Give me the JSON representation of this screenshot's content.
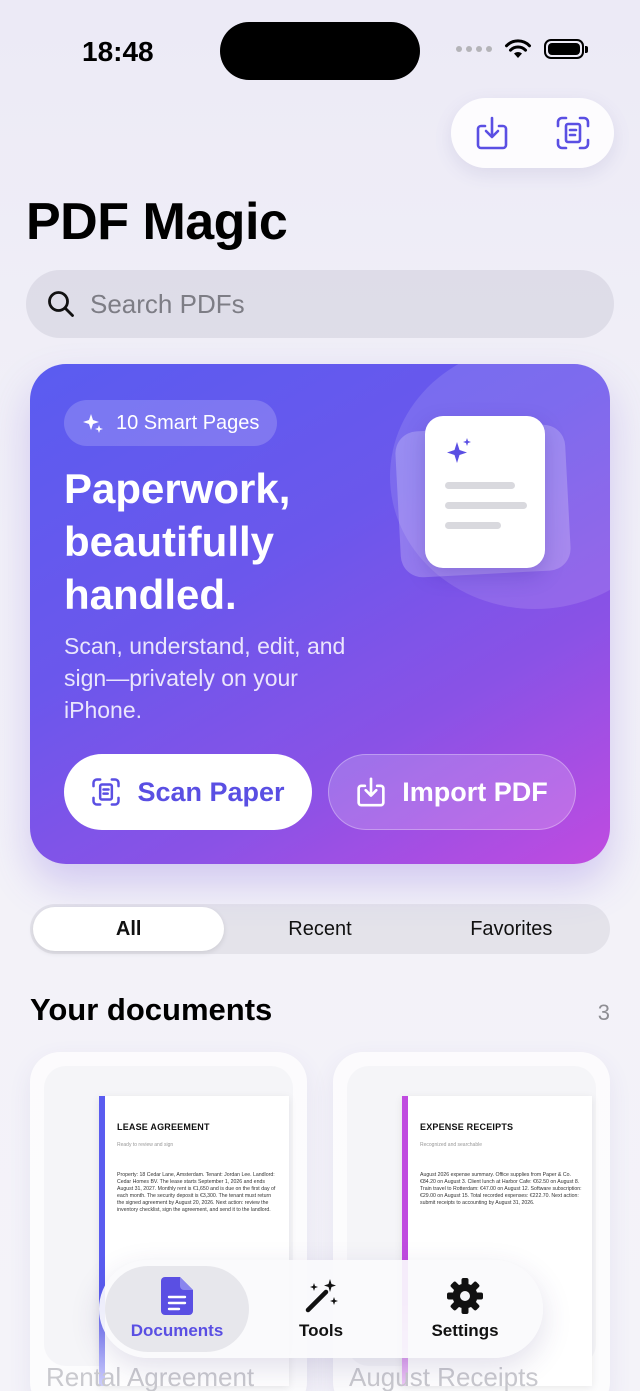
{
  "status": {
    "time": "18:48"
  },
  "app": {
    "title": "PDF Magic"
  },
  "top_actions": {
    "import_icon": "tray-arrow-down-icon",
    "scan_icon": "document-scanner-icon"
  },
  "search": {
    "placeholder": "Search PDFs",
    "value": ""
  },
  "hero": {
    "badge": "10 Smart Pages",
    "title": "Paperwork, beautifully handled.",
    "subtitle": "Scan, understand, edit, and sign—privately on your iPhone.",
    "scan_button": "Scan Paper",
    "import_button": "Import PDF"
  },
  "filters": {
    "tabs": [
      "All",
      "Recent",
      "Favorites"
    ],
    "selected": "All"
  },
  "section": {
    "title": "Your documents",
    "count": "3"
  },
  "documents": [
    {
      "name": "Rental Agreement",
      "page_title": "LEASE AGREEMENT",
      "page_subtitle": "Ready to review and sign",
      "page_body": "Property: 18 Cedar Lane, Amsterdam. Tenant: Jordan Lee. Landlord: Cedar Homes BV. The lease starts September 1, 2026 and ends August 31, 2027. Monthly rent is €1,650 and is due on the first day of each month. The security deposit is €3,300. The tenant must return the signed agreement by August 20, 2026. Next action: review the inventory checklist, sign the agreement, and send it to the landlord."
    },
    {
      "name": "August Receipts",
      "page_title": "EXPENSE RECEIPTS",
      "page_subtitle": "Recognized and searchable",
      "page_body": "August 2026 expense summary. Office supplies from Paper & Co. €84.20 on August 3. Client lunch at Harbor Cafe: €62.50 on August 8. Train travel to Rotterdam: €47.00 on August 12. Software subscription: €29.00 on August 15. Total recorded expenses: €222.70. Next action: submit receipts to accounting by August 31, 2026."
    }
  ],
  "tabbar": {
    "items": [
      {
        "label": "Documents",
        "icon": "document-icon"
      },
      {
        "label": "Tools",
        "icon": "magic-wand-icon"
      },
      {
        "label": "Settings",
        "icon": "gear-icon"
      }
    ],
    "selected": "Documents"
  },
  "colors": {
    "accent": "#5a4fe3",
    "hero_start": "#5a5cf0",
    "hero_end": "#c04be0"
  }
}
